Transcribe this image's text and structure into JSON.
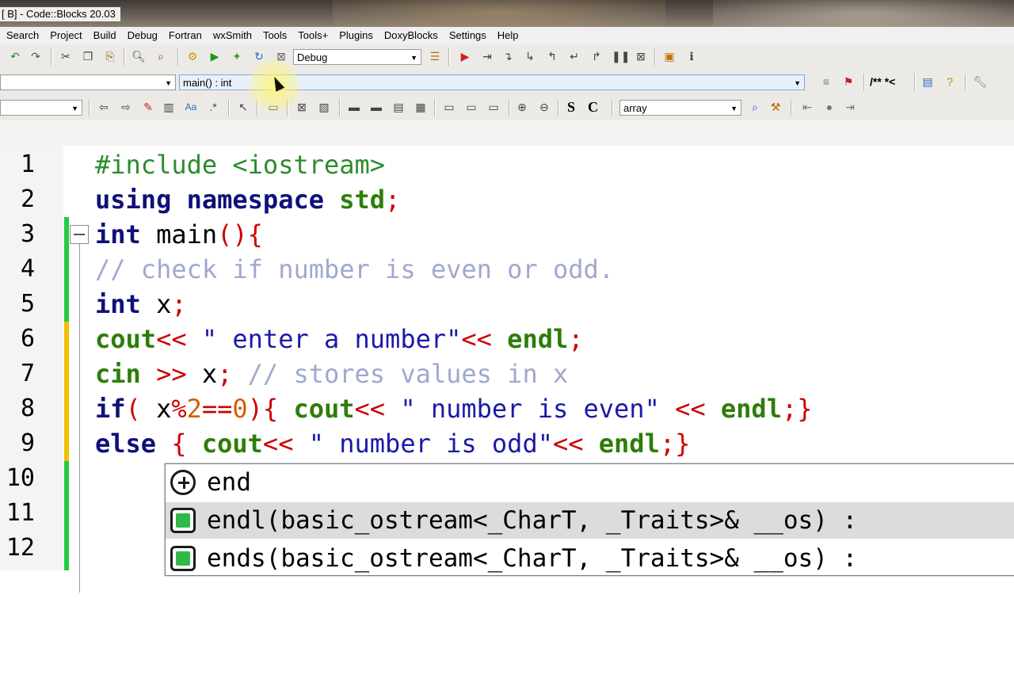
{
  "window": {
    "title": "[ B] - Code::Blocks 20.03"
  },
  "menu": [
    "Search",
    "Project",
    "Build",
    "Debug",
    "Fortran",
    "wxSmith",
    "Tools",
    "Tools+",
    "Plugins",
    "DoxyBlocks",
    "Settings",
    "Help"
  ],
  "toolbar1": {
    "build_target": "Debug"
  },
  "toolbar2": {
    "scope_value": "",
    "function_value": "main() : int",
    "doxy_label": "/** *<"
  },
  "toolbar3": {
    "search_value": "",
    "bold_s": "S",
    "bold_c": "C",
    "symbol_value": "array"
  },
  "editor": {
    "line_numbers": [
      "1",
      "2",
      "3",
      "4",
      "5",
      "6",
      "7",
      "8",
      "9",
      "10",
      "11",
      "12"
    ],
    "lines": [
      [
        {
          "t": "#include <iostream>",
          "c": "pp"
        }
      ],
      [
        {
          "t": "using namespace ",
          "c": "kw"
        },
        {
          "t": "std",
          "c": "sd"
        },
        {
          "t": ";",
          "c": "sy"
        }
      ],
      [
        {
          "t": "int",
          "c": "kw"
        },
        {
          "t": " main",
          "c": "id"
        },
        {
          "t": "(){",
          "c": "sy"
        }
      ],
      [
        {
          "t": "// check if number is even or odd.",
          "c": "cm"
        }
      ],
      [
        {
          "t": "int",
          "c": "kw"
        },
        {
          "t": " x",
          "c": "id"
        },
        {
          "t": ";",
          "c": "sy"
        }
      ],
      [
        {
          "t": "cout",
          "c": "sd"
        },
        {
          "t": "<< ",
          "c": "sy"
        },
        {
          "t": "\" enter a number\"",
          "c": "st"
        },
        {
          "t": "<< ",
          "c": "sy"
        },
        {
          "t": "endl",
          "c": "sd"
        },
        {
          "t": ";",
          "c": "sy"
        }
      ],
      [
        {
          "t": "cin",
          "c": "sd"
        },
        {
          "t": " >> ",
          "c": "sy"
        },
        {
          "t": "x",
          "c": "id"
        },
        {
          "t": "; ",
          "c": "sy"
        },
        {
          "t": "// stores values in x",
          "c": "cm"
        }
      ],
      [
        {
          "t": "if",
          "c": "kw"
        },
        {
          "t": "( ",
          "c": "sy"
        },
        {
          "t": "x",
          "c": "id"
        },
        {
          "t": "%",
          "c": "sy"
        },
        {
          "t": "2",
          "c": "nm"
        },
        {
          "t": "==",
          "c": "sy"
        },
        {
          "t": "0",
          "c": "nm"
        },
        {
          "t": "){ ",
          "c": "sy"
        },
        {
          "t": "cout",
          "c": "sd"
        },
        {
          "t": "<< ",
          "c": "sy"
        },
        {
          "t": "\" number is even\"",
          "c": "st"
        },
        {
          "t": " << ",
          "c": "sy"
        },
        {
          "t": "endl",
          "c": "sd"
        },
        {
          "t": ";}",
          "c": "sy"
        }
      ],
      [
        {
          "t": "else",
          "c": "kw"
        },
        {
          "t": " { ",
          "c": "sy"
        },
        {
          "t": "cout",
          "c": "sd"
        },
        {
          "t": "<< ",
          "c": "sy"
        },
        {
          "t": "\" number is odd\"",
          "c": "st"
        },
        {
          "t": "<< ",
          "c": "sy"
        },
        {
          "t": "endl",
          "c": "sd"
        },
        {
          "t": ";}",
          "c": "sy"
        }
      ]
    ]
  },
  "autocomplete": {
    "items": [
      {
        "icon": "namespace-icon",
        "text": "end"
      },
      {
        "icon": "function-icon",
        "text": "endl(basic_ostream<_CharT, _Traits>& __os) :",
        "selected": true
      },
      {
        "icon": "function-icon",
        "text": "ends(basic_ostream<_CharT, _Traits>& __os) :"
      }
    ]
  },
  "colors": {
    "preprocessor": "#2e8b2e",
    "keyword": "#10107a",
    "std": "#2e7d0a",
    "symbol": "#cc0000",
    "string": "#1a1aa8",
    "comment": "#a0a8d0",
    "number": "#d06000",
    "changebar_saved": "#22cc44",
    "changebar_unsaved": "#f0c000"
  }
}
